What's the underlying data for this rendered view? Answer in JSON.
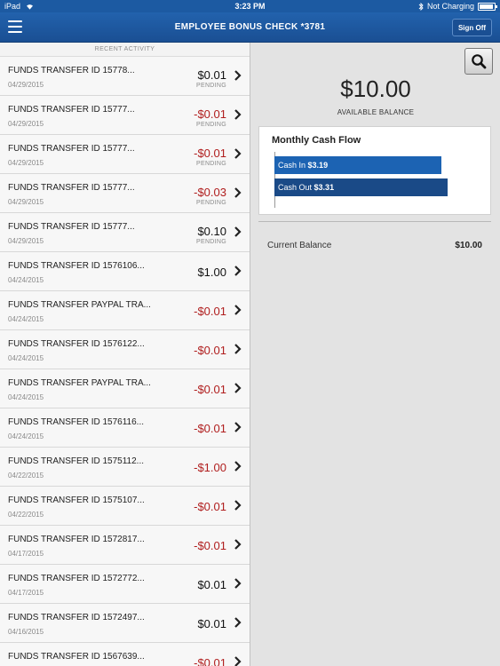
{
  "status_bar": {
    "device": "iPad",
    "time": "3:23 PM",
    "charging": "Not Charging",
    "battery_level": 0.95
  },
  "nav": {
    "title": "EMPLOYEE BONUS CHECK *3781",
    "sign_off": "Sign Off",
    "menu_icon": "hamburger-menu-icon"
  },
  "recent_activity": {
    "header": "RECENT ACTIVITY",
    "rows": [
      {
        "name": "FUNDS TRANSFER ID 15778...",
        "date": "04/29/2015",
        "amount": "$0.01",
        "negative": false,
        "status": "PENDING"
      },
      {
        "name": "FUNDS TRANSFER ID 15777...",
        "date": "04/29/2015",
        "amount": "-$0.01",
        "negative": true,
        "status": "PENDING"
      },
      {
        "name": "FUNDS TRANSFER ID 15777...",
        "date": "04/29/2015",
        "amount": "-$0.01",
        "negative": true,
        "status": "PENDING"
      },
      {
        "name": "FUNDS TRANSFER ID 15777...",
        "date": "04/29/2015",
        "amount": "-$0.03",
        "negative": true,
        "status": "PENDING"
      },
      {
        "name": "FUNDS TRANSFER ID 15777...",
        "date": "04/29/2015",
        "amount": "$0.10",
        "negative": false,
        "status": "PENDING"
      },
      {
        "name": "FUNDS TRANSFER ID 1576106...",
        "date": "04/24/2015",
        "amount": "$1.00",
        "negative": false,
        "status": ""
      },
      {
        "name": "FUNDS TRANSFER PAYPAL TRA...",
        "date": "04/24/2015",
        "amount": "-$0.01",
        "negative": true,
        "status": ""
      },
      {
        "name": "FUNDS TRANSFER ID 1576122...",
        "date": "04/24/2015",
        "amount": "-$0.01",
        "negative": true,
        "status": ""
      },
      {
        "name": "FUNDS TRANSFER PAYPAL TRA...",
        "date": "04/24/2015",
        "amount": "-$0.01",
        "negative": true,
        "status": ""
      },
      {
        "name": "FUNDS TRANSFER ID 1576116...",
        "date": "04/24/2015",
        "amount": "-$0.01",
        "negative": true,
        "status": ""
      },
      {
        "name": "FUNDS TRANSFER ID 1575112...",
        "date": "04/22/2015",
        "amount": "-$1.00",
        "negative": true,
        "status": ""
      },
      {
        "name": "FUNDS TRANSFER ID 1575107...",
        "date": "04/22/2015",
        "amount": "-$0.01",
        "negative": true,
        "status": ""
      },
      {
        "name": "FUNDS TRANSFER ID 1572817...",
        "date": "04/17/2015",
        "amount": "-$0.01",
        "negative": true,
        "status": ""
      },
      {
        "name": "FUNDS TRANSFER ID 1572772...",
        "date": "04/17/2015",
        "amount": "$0.01",
        "negative": false,
        "status": ""
      },
      {
        "name": "FUNDS TRANSFER ID 1572497...",
        "date": "04/16/2015",
        "amount": "$0.01",
        "negative": false,
        "status": ""
      },
      {
        "name": "FUNDS TRANSFER ID 1567639...",
        "date": "",
        "amount": "-$0.01",
        "negative": true,
        "status": ""
      }
    ]
  },
  "account": {
    "balance": "$10.00",
    "balance_label": "AVAILABLE BALANCE",
    "current_balance_label": "Current Balance",
    "current_balance_value": "$10.00"
  },
  "cash_flow": {
    "title": "Monthly Cash Flow",
    "in_label": "Cash In",
    "in_value_text": "$3.19",
    "in_value": 3.19,
    "out_label": "Cash Out",
    "out_value_text": "$3.31",
    "out_value": 3.31
  },
  "colors": {
    "brand_blue": "#1c5aa2",
    "negative_red": "#b01e1e",
    "cash_in": "#1c63b3",
    "cash_out": "#1a4a87"
  }
}
